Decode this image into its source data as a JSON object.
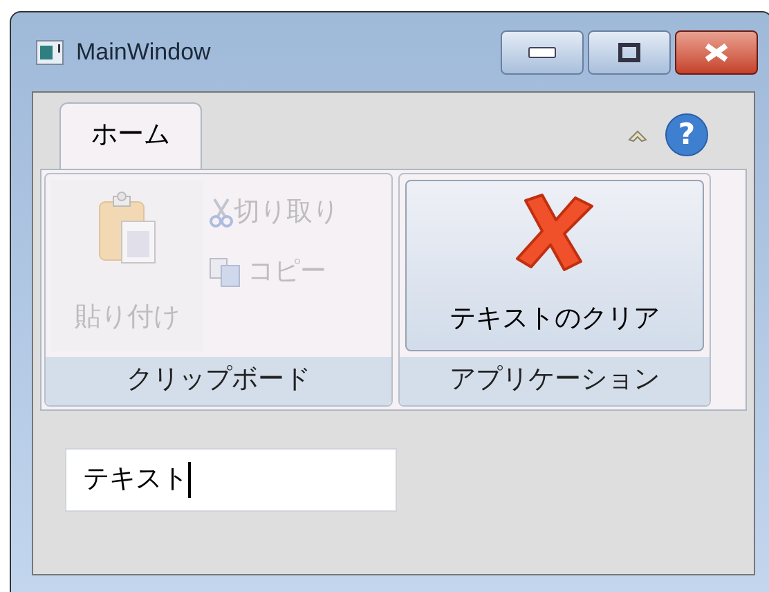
{
  "window": {
    "title": "MainWindow"
  },
  "tabs": [
    {
      "label": "ホーム",
      "selected": true
    }
  ],
  "help_button": {
    "label": "?"
  },
  "groups": [
    {
      "label": "クリップボード",
      "items": [
        {
          "kind": "large",
          "label": "貼り付け",
          "disabled": true
        },
        {
          "kind": "small",
          "label": "切り取り",
          "disabled": true
        },
        {
          "kind": "small",
          "label": "コピー",
          "disabled": true
        }
      ]
    },
    {
      "label": "アプリケーション",
      "items": [
        {
          "kind": "large",
          "label": "テキストのクリア",
          "disabled": false
        }
      ]
    }
  ],
  "text_field": {
    "value": "テキスト"
  }
}
